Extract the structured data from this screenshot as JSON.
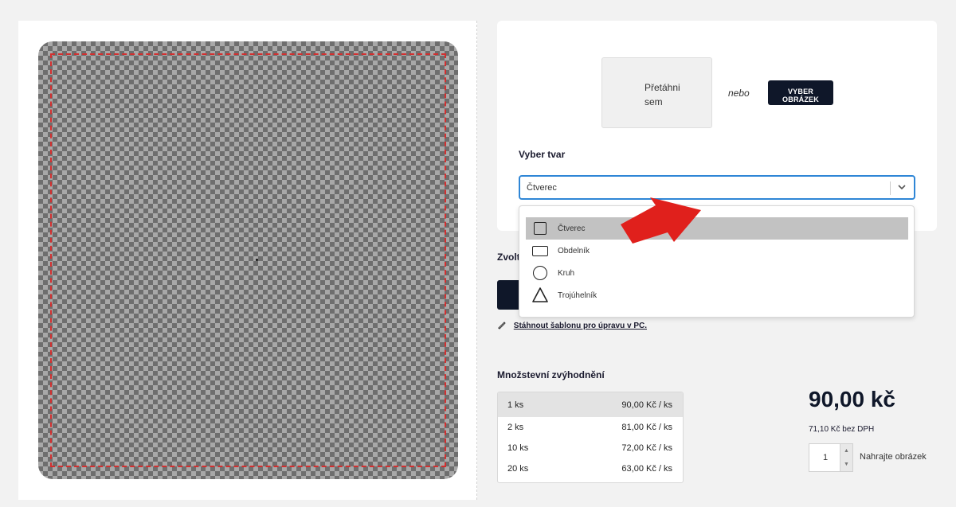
{
  "upload": {
    "dropzone_line1": "Přetáhni",
    "dropzone_line2": "sem",
    "or_text": "nebo",
    "choose_button_line1": "VYBER",
    "choose_button_line2": "OBRÁZEK"
  },
  "shape": {
    "label": "Vyber tvar",
    "selected_value": "Čtverec",
    "options": [
      {
        "label": "Čtverec",
        "icon": "square-icon",
        "selected": true
      },
      {
        "label": "Obdelník",
        "icon": "rectangle-icon",
        "selected": false
      },
      {
        "label": "Kruh",
        "icon": "circle-icon",
        "selected": false
      },
      {
        "label": "Trojúhelník",
        "icon": "triangle-icon",
        "selected": false
      }
    ]
  },
  "section": {
    "partial_heading": "Zvolt"
  },
  "template_link": {
    "text": "Stáhnout šablonu pro úpravu v PC.",
    "icon": "pencil-icon"
  },
  "quantity_discounts": {
    "title": "Množstevní zvýhodnění",
    "rows": [
      {
        "qty": "1 ks",
        "price": "90,00 Kč / ks",
        "active": true
      },
      {
        "qty": "2 ks",
        "price": "81,00 Kč / ks",
        "active": false
      },
      {
        "qty": "10 ks",
        "price": "72,00 Kč / ks",
        "active": false
      },
      {
        "qty": "20 ks",
        "price": "63,00 Kč / ks",
        "active": false
      }
    ]
  },
  "pricing": {
    "price": "90,00 kč",
    "price_without_vat": "71,10 Kč bez DPH",
    "quantity": "1",
    "upload_hint": "Nahrajte obrázek"
  },
  "colors": {
    "accent_dark": "#0f1729",
    "focus_blue": "#2f86d6",
    "safe_zone_red": "#d32f2f",
    "arrow_red": "#e0201c"
  }
}
